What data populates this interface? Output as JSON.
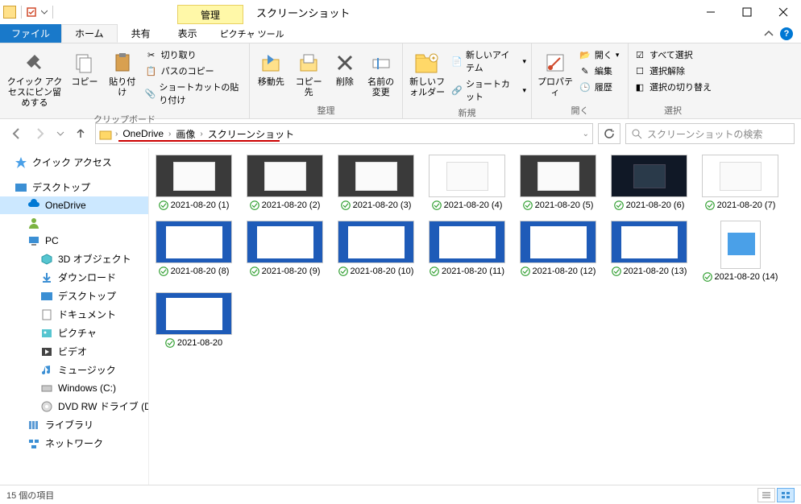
{
  "titlebar": {
    "context_tab": "管理",
    "window_title": "スクリーンショット"
  },
  "tabs": {
    "file": "ファイル",
    "home": "ホーム",
    "share": "共有",
    "view": "表示",
    "tools": "ピクチャ ツール"
  },
  "ribbon": {
    "clipboard": {
      "pin": "クイック アクセスにピン留めする",
      "copy": "コピー",
      "paste": "貼り付け",
      "cut": "切り取り",
      "copypath": "パスのコピー",
      "pasteshortcut": "ショートカットの貼り付け",
      "label": "クリップボード"
    },
    "organize": {
      "moveto": "移動先",
      "copyto": "コピー先",
      "delete": "削除",
      "rename": "名前の変更",
      "label": "整理"
    },
    "new": {
      "newfolder": "新しいフォルダー",
      "newitem": "新しいアイテム",
      "shortcut": "ショートカット",
      "label": "新規"
    },
    "open": {
      "properties": "プロパティ",
      "open": "開く",
      "edit": "編集",
      "history": "履歴",
      "label": "開く"
    },
    "select": {
      "selectall": "すべて選択",
      "selectnone": "選択解除",
      "invert": "選択の切り替え",
      "label": "選択"
    }
  },
  "breadcrumb": {
    "seg1": "OneDrive",
    "seg2": "画像",
    "seg3": "スクリーンショット"
  },
  "search_placeholder": "スクリーンショットの検索",
  "nav": {
    "quick": "クイック アクセス",
    "desktop": "デスクトップ",
    "onedrive": "OneDrive",
    "user": " ",
    "pc": "PC",
    "threed": "3D オブジェクト",
    "downloads": "ダウンロード",
    "desktop2": "デスクトップ",
    "documents": "ドキュメント",
    "pictures": "ピクチャ",
    "videos": "ビデオ",
    "music": "ミュージック",
    "cdrive": "Windows (C:)",
    "dvd": "DVD RW ドライブ (D",
    "libraries": "ライブラリ",
    "network": "ネットワーク"
  },
  "files": [
    {
      "name": "2021-08-20 (1)",
      "style": "dark"
    },
    {
      "name": "2021-08-20 (2)",
      "style": "dark"
    },
    {
      "name": "2021-08-20 (3)",
      "style": "dark"
    },
    {
      "name": "2021-08-20 (4)",
      "style": "light"
    },
    {
      "name": "2021-08-20 (5)",
      "style": "dark"
    },
    {
      "name": "2021-08-20 (6)",
      "style": "darkmix"
    },
    {
      "name": "2021-08-20 (7)",
      "style": "light"
    },
    {
      "name": "2021-08-20 (8)",
      "style": "blue"
    },
    {
      "name": "2021-08-20 (9)",
      "style": "blue"
    },
    {
      "name": "2021-08-20 (10)",
      "style": "blue"
    },
    {
      "name": "2021-08-20 (11)",
      "style": "blue"
    },
    {
      "name": "2021-08-20 (12)",
      "style": "blue"
    },
    {
      "name": "2021-08-20 (13)",
      "style": "blue"
    },
    {
      "name": "2021-08-20 (14)",
      "style": "placeholder"
    },
    {
      "name": "2021-08-20",
      "style": "blue"
    }
  ],
  "status": "15 個の項目"
}
